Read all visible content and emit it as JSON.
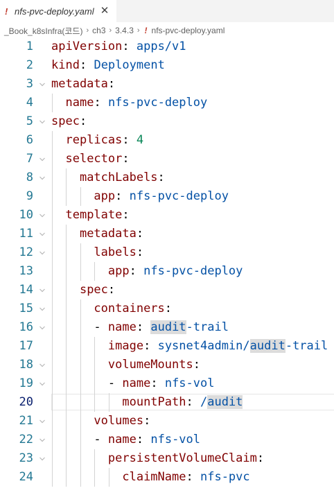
{
  "tab": {
    "icon": "yaml-exclamation-icon",
    "bang": "!",
    "title": "nfs-pvc-deploy.yaml",
    "close_glyph": "✕"
  },
  "breadcrumb": {
    "items": [
      "_Book_k8sInfra(코드)",
      "ch3",
      "3.4.3"
    ],
    "separator": "›",
    "file_bang": "!",
    "file": "nfs-pvc-deploy.yaml"
  },
  "editor": {
    "current_line": 20,
    "lines": [
      {
        "n": "1",
        "indent": 0,
        "key": "apiVersion",
        "value": "apps/v1",
        "fold": false
      },
      {
        "n": "2",
        "indent": 0,
        "key": "kind",
        "value": "Deployment",
        "fold": false
      },
      {
        "n": "3",
        "indent": 0,
        "key": "metadata",
        "value": "",
        "fold": true
      },
      {
        "n": "4",
        "indent": 1,
        "key": "name",
        "value": "nfs-pvc-deploy",
        "fold": false
      },
      {
        "n": "5",
        "indent": 0,
        "key": "spec",
        "value": "",
        "fold": true
      },
      {
        "n": "6",
        "indent": 1,
        "key": "replicas",
        "value": "4",
        "num": true,
        "fold": false
      },
      {
        "n": "7",
        "indent": 1,
        "key": "selector",
        "value": "",
        "fold": true
      },
      {
        "n": "8",
        "indent": 2,
        "key": "matchLabels",
        "value": "",
        "fold": true
      },
      {
        "n": "9",
        "indent": 3,
        "key": "app",
        "value": "nfs-pvc-deploy",
        "fold": false
      },
      {
        "n": "10",
        "indent": 1,
        "key": "template",
        "value": "",
        "fold": true
      },
      {
        "n": "11",
        "indent": 2,
        "key": "metadata",
        "value": "",
        "fold": true
      },
      {
        "n": "12",
        "indent": 3,
        "key": "labels",
        "value": "",
        "fold": true
      },
      {
        "n": "13",
        "indent": 4,
        "key": "app",
        "value": "nfs-pvc-deploy",
        "fold": false
      },
      {
        "n": "14",
        "indent": 2,
        "key": "spec",
        "value": "",
        "fold": true
      },
      {
        "n": "15",
        "indent": 3,
        "key": "containers",
        "value": "",
        "fold": true
      },
      {
        "n": "16",
        "indent": 3,
        "dash": true,
        "key": "name",
        "value": "audit-trail",
        "sel": "audit",
        "fold": true
      },
      {
        "n": "17",
        "indent": 4,
        "key": "image",
        "value": "sysnet4admin/audit-trail",
        "selpre": "sysnet4admin/",
        "sel": "audit",
        "selpost": "-trail",
        "fold": false
      },
      {
        "n": "18",
        "indent": 4,
        "key": "volumeMounts",
        "value": "",
        "fold": true
      },
      {
        "n": "19",
        "indent": 4,
        "dash": true,
        "key": "name",
        "value": "nfs-vol",
        "fold": true
      },
      {
        "n": "20",
        "indent": 5,
        "key": "mountPath",
        "value": "/audit",
        "selpre": "/",
        "sel": "audit",
        "selpost": "",
        "fold": false
      },
      {
        "n": "21",
        "indent": 3,
        "key": "volumes",
        "value": "",
        "fold": true
      },
      {
        "n": "22",
        "indent": 3,
        "dash": true,
        "key": "name",
        "value": "nfs-vol",
        "fold": true
      },
      {
        "n": "23",
        "indent": 4,
        "key": "persistentVolumeClaim",
        "value": "",
        "fold": true
      },
      {
        "n": "24",
        "indent": 5,
        "key": "claimName",
        "value": "nfs-pvc",
        "fold": false
      }
    ]
  }
}
